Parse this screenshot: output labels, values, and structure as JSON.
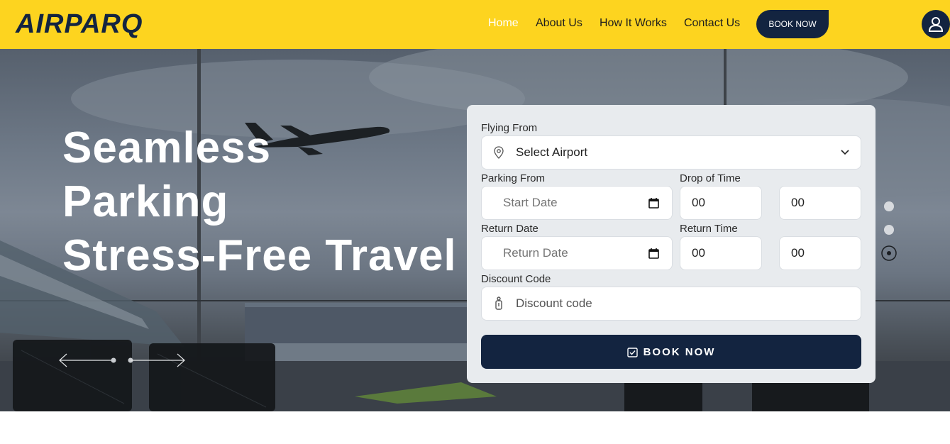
{
  "header": {
    "logo": "AIRPARQ",
    "nav": [
      {
        "label": "Home",
        "active": true
      },
      {
        "label": "About Us",
        "active": false
      },
      {
        "label": "How It Works",
        "active": false
      },
      {
        "label": "Contact Us",
        "active": false
      }
    ],
    "book_now": "BOOK NOW",
    "user_icon": "user-icon",
    "colors": {
      "bar": "#fdd41f",
      "dark": "#132440"
    }
  },
  "hero": {
    "title_lines": [
      "Seamless",
      "Parking",
      "Stress-Free Travel"
    ],
    "slide_count": 3,
    "active_slide": 3
  },
  "form": {
    "flying_from_label": "Flying From",
    "airport_select": "Select Airport",
    "parking_from_label": "Parking From",
    "start_date_placeholder": "Start Date",
    "drop_time_label": "Drop of Time",
    "drop_hour": "00",
    "drop_minute": "00",
    "return_date_label": "Return Date",
    "return_date_placeholder": "Return Date",
    "return_time_label": "Return Time",
    "return_hour": "00",
    "return_minute": "00",
    "discount_label": "Discount Code",
    "discount_placeholder": "Discount code",
    "submit": "BOOK NOW"
  }
}
